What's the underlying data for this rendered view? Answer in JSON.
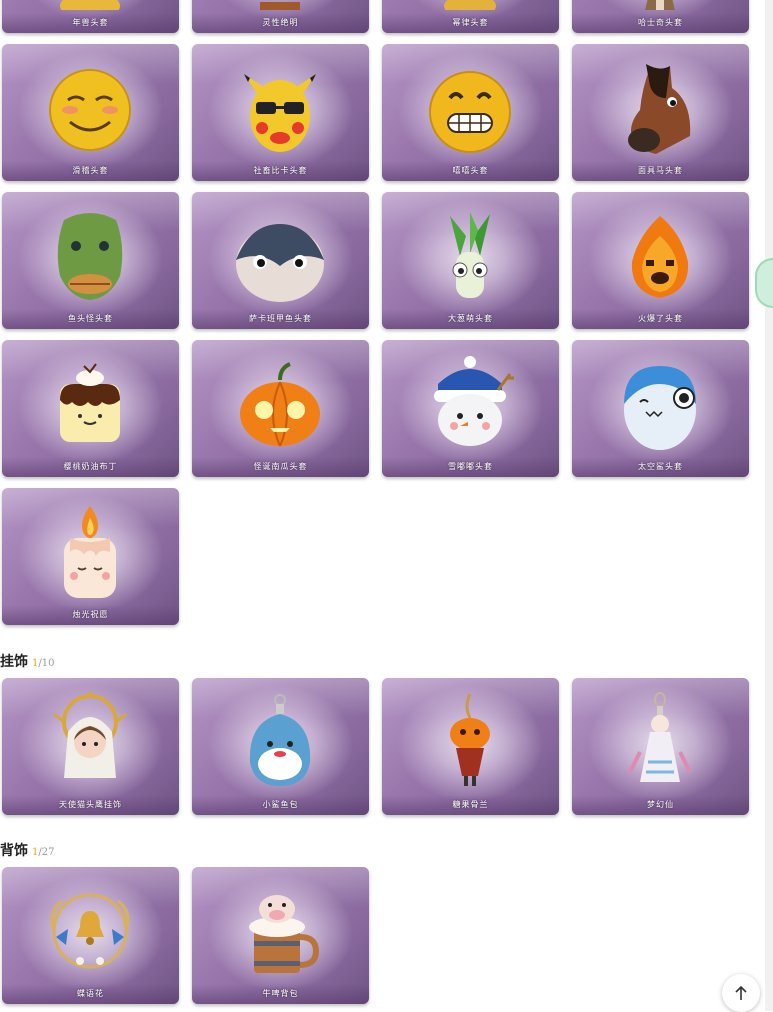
{
  "heads_partial": [
    {
      "label": "年兽头套"
    },
    {
      "label": "灵性绝明"
    },
    {
      "label": "幂律头套"
    },
    {
      "label": "哈士奇头套"
    }
  ],
  "heads": [
    {
      "label": "滑稽头套",
      "icon": "smiley-face-icon"
    },
    {
      "label": "社畜比卡头套",
      "icon": "yellow-mouse-sunglasses-icon"
    },
    {
      "label": "嘻嘻头套",
      "icon": "grin-face-icon"
    },
    {
      "label": "面具马头套",
      "icon": "horse-head-icon"
    },
    {
      "label": "鱼头怪头套",
      "icon": "fish-head-icon"
    },
    {
      "label": "萨卡班甲鱼头套",
      "icon": "round-fish-icon"
    },
    {
      "label": "大葱萌头套",
      "icon": "scallion-icon"
    },
    {
      "label": "火爆了头套",
      "icon": "fireball-icon"
    },
    {
      "label": "樱桃奶油布丁",
      "icon": "pudding-icon"
    },
    {
      "label": "怪诞南瓜头套",
      "icon": "pumpkin-icon"
    },
    {
      "label": "雪嘟嘟头套",
      "icon": "snowman-icon"
    },
    {
      "label": "太空鲨头套",
      "icon": "shark-icon"
    },
    {
      "label": "烛光祝愿",
      "icon": "candle-icon"
    }
  ],
  "pendants": {
    "title": "挂饰",
    "count_owned": "1",
    "count_total": "/10",
    "items": [
      {
        "label": "天使猫头鹰挂饰",
        "icon": "angel-doll-icon"
      },
      {
        "label": "小鲨鱼包",
        "icon": "shark-bag-icon"
      },
      {
        "label": "糖果骨兰",
        "icon": "pumpkin-pendant-icon"
      },
      {
        "label": "梦幻仙",
        "icon": "fairy-pendant-icon"
      }
    ]
  },
  "backs": {
    "title": "背饰",
    "count_owned": "1",
    "count_total": "/27",
    "items": [
      {
        "label": "蝶语花",
        "icon": "bell-wreath-icon"
      },
      {
        "label": "牛啤背包",
        "icon": "cow-mug-icon"
      }
    ]
  },
  "colors": {
    "card_purple": "#9a78ad",
    "owned_orange": "#f0a020"
  }
}
